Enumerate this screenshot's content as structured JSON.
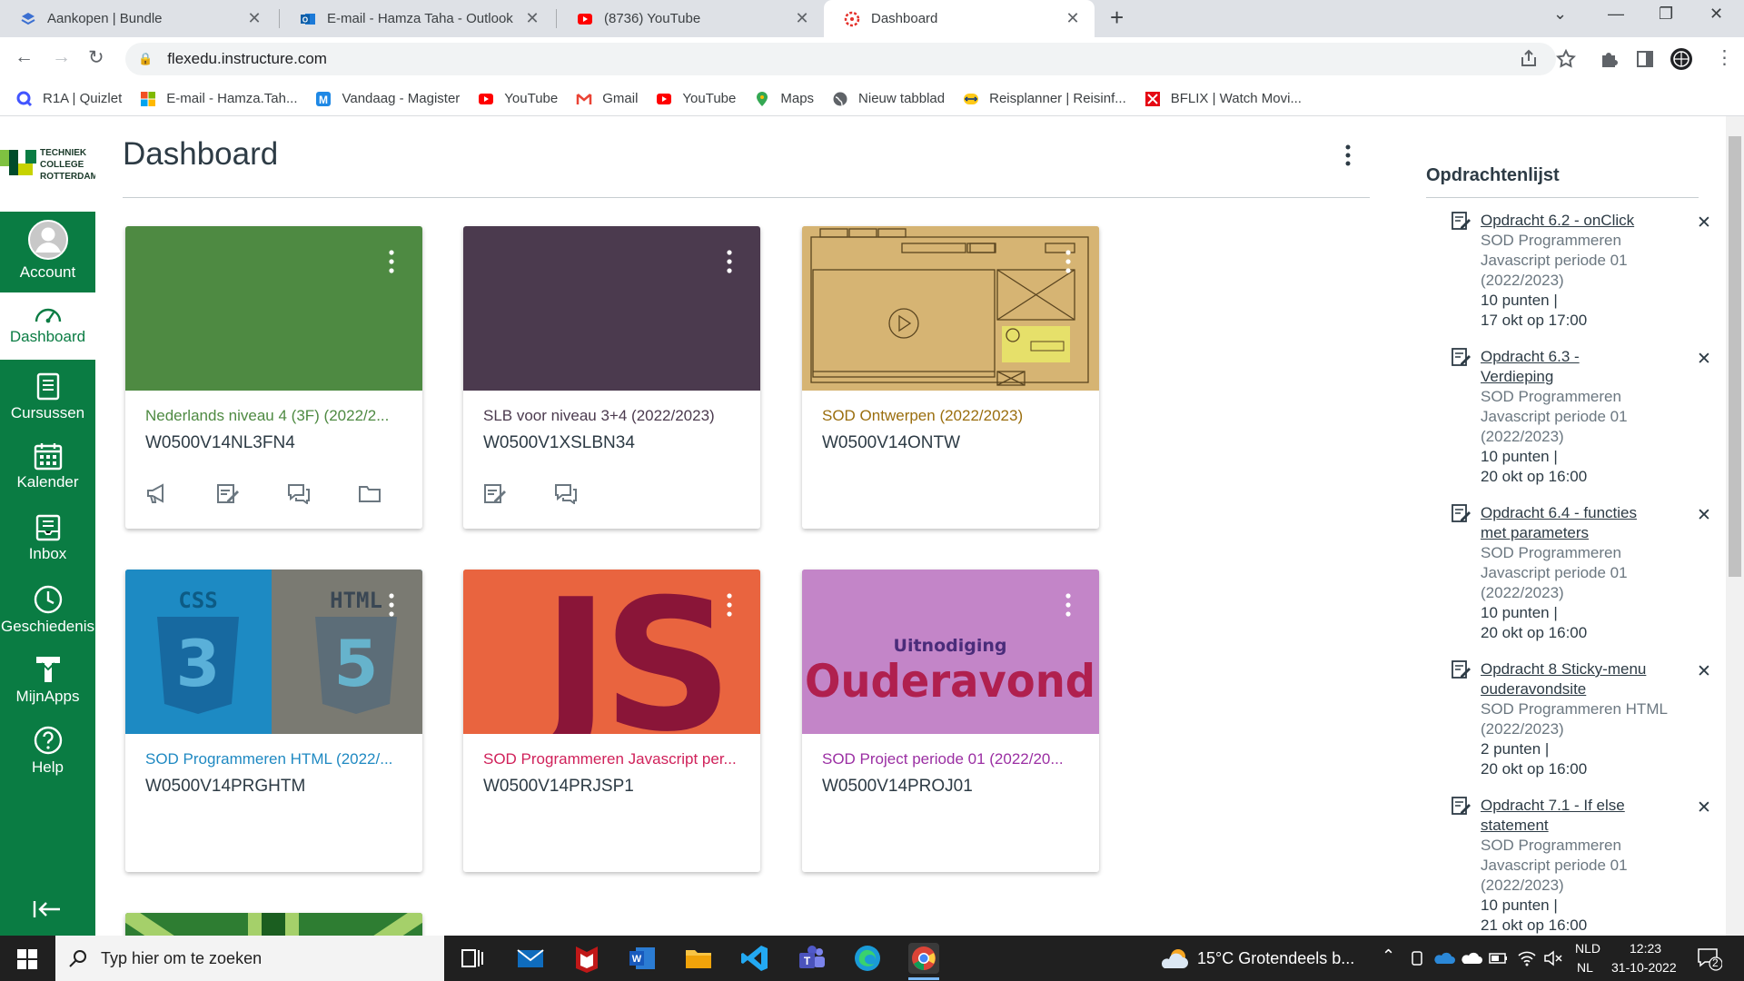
{
  "browser": {
    "tabs": [
      {
        "title": "Aankopen | Bundle",
        "icon": "bundle-icon",
        "active": false
      },
      {
        "title": "E-mail - Hamza Taha - Outlook",
        "icon": "outlook-icon",
        "active": false
      },
      {
        "title": "(8736) YouTube",
        "icon": "youtube-icon",
        "active": false
      },
      {
        "title": "Dashboard",
        "icon": "canvas-icon",
        "active": true
      }
    ],
    "url": "flexedu.instructure.com",
    "bookmarks": [
      {
        "label": "R1A | Quizlet",
        "icon": "quizlet-icon",
        "color": "#4255ff"
      },
      {
        "label": "E-mail - Hamza.Tah...",
        "icon": "microsoft-icon",
        "color": "#f25022"
      },
      {
        "label": "Vandaag - Magister",
        "icon": "magister-icon",
        "color": "#1e88e5"
      },
      {
        "label": "YouTube",
        "icon": "youtube-icon",
        "color": "#ff0000"
      },
      {
        "label": "Gmail",
        "icon": "gmail-icon",
        "color": "#ea4335"
      },
      {
        "label": "YouTube",
        "icon": "youtube-icon",
        "color": "#ff0000"
      },
      {
        "label": "Maps",
        "icon": "maps-icon",
        "color": "#34a853"
      },
      {
        "label": "Nieuw tabblad",
        "icon": "globe-icon",
        "color": "#5f6368"
      },
      {
        "label": "Reisplanner | Reisinf...",
        "icon": "ns-icon",
        "color": "#ffc917"
      },
      {
        "label": "BFLIX | Watch Movi...",
        "icon": "bflix-icon",
        "color": "#e50914"
      }
    ]
  },
  "sidebar": {
    "logo_lines": [
      "TECHNIEK",
      "COLLEGE",
      "ROTTERDAM"
    ],
    "items": [
      {
        "label": "Account",
        "icon": "account-icon",
        "active": false
      },
      {
        "label": "Dashboard",
        "icon": "dashboard-icon",
        "active": true
      },
      {
        "label": "Cursussen",
        "icon": "courses-icon",
        "active": false
      },
      {
        "label": "Kalender",
        "icon": "calendar-icon",
        "active": false
      },
      {
        "label": "Inbox",
        "icon": "inbox-icon",
        "active": false
      },
      {
        "label": "Geschiedenis",
        "icon": "history-icon",
        "active": false
      },
      {
        "label": "MijnApps",
        "icon": "apps-icon",
        "active": false
      },
      {
        "label": "Help",
        "icon": "help-icon",
        "active": false
      }
    ]
  },
  "dashboard": {
    "title": "Dashboard",
    "cards": [
      {
        "name": "Nederlands niveau 4 (3F) (2022/2...",
        "code": "W0500V14NL3FN4",
        "color": "#4e8a42",
        "name_color": "#4e8a42"
      },
      {
        "name": "SLB voor niveau 3+4 (2022/2023)",
        "code": "W0500V1XSLBN34",
        "color": "#4b3a4e",
        "name_color": "#4b3a4e"
      },
      {
        "name": "SOD Ontwerpen (2022/2023)",
        "code": "W0500V14ONTW",
        "color": "#d4b06a",
        "name_color": "#9a6e0e"
      },
      {
        "name": "SOD Programmeren HTML (2022/...",
        "code": "W0500V14PRGHTM",
        "color": "#1f89c2",
        "name_color": "#1f89c2"
      },
      {
        "name": "SOD Programmeren Javascript per...",
        "code": "W0500V14PRJSP1",
        "color": "#e9643f",
        "name_color": "#d0215a"
      },
      {
        "name": "SOD Project periode 01 (2022/20...",
        "code": "W0500V14PROJ01",
        "color": "#c385c8",
        "name_color": "#9b2fa3"
      }
    ],
    "card_images": {
      "css_label": "CSS",
      "css_number": "3",
      "html_label": "HTML",
      "html_number": "5",
      "js_label": "JS",
      "invite_small": "Uitnodiging",
      "invite_big": "Ouderavond"
    }
  },
  "todo": {
    "heading": "Opdrachtenlijst",
    "items": [
      {
        "title": "Opdracht 6.2 - onClick",
        "course": "SOD Programmeren Javascript periode 01 (2022/2023)",
        "points": "10 punten  |",
        "due": "17 okt op 17:00"
      },
      {
        "title": "Opdracht 6.3 - Verdieping",
        "course": "SOD Programmeren Javascript periode 01 (2022/2023)",
        "points": "10 punten  |",
        "due": "20 okt op 16:00"
      },
      {
        "title": "Opdracht 6.4 - functies met parameters",
        "course": "SOD Programmeren Javascript periode 01 (2022/2023)",
        "points": "10 punten  |",
        "due": "20 okt op 16:00"
      },
      {
        "title": "Opdracht 8 Sticky-menu ouderavondsite",
        "course": "SOD Programmeren HTML (2022/2023)",
        "points": "2 punten  |",
        "due": "20 okt op 16:00"
      },
      {
        "title": "Opdracht 7.1 - If else statement",
        "course": "SOD Programmeren Javascript periode 01 (2022/2023)",
        "points": "10 punten  |",
        "due": "21 okt op 16:00"
      }
    ]
  },
  "taskbar": {
    "search_placeholder": "Typ hier om te zoeken",
    "weather": "15°C  Grotendeels b...",
    "lang_top": "NLD",
    "lang_bottom": "NL",
    "time": "12:23",
    "date": "31-10-2022",
    "notifications": "2"
  }
}
